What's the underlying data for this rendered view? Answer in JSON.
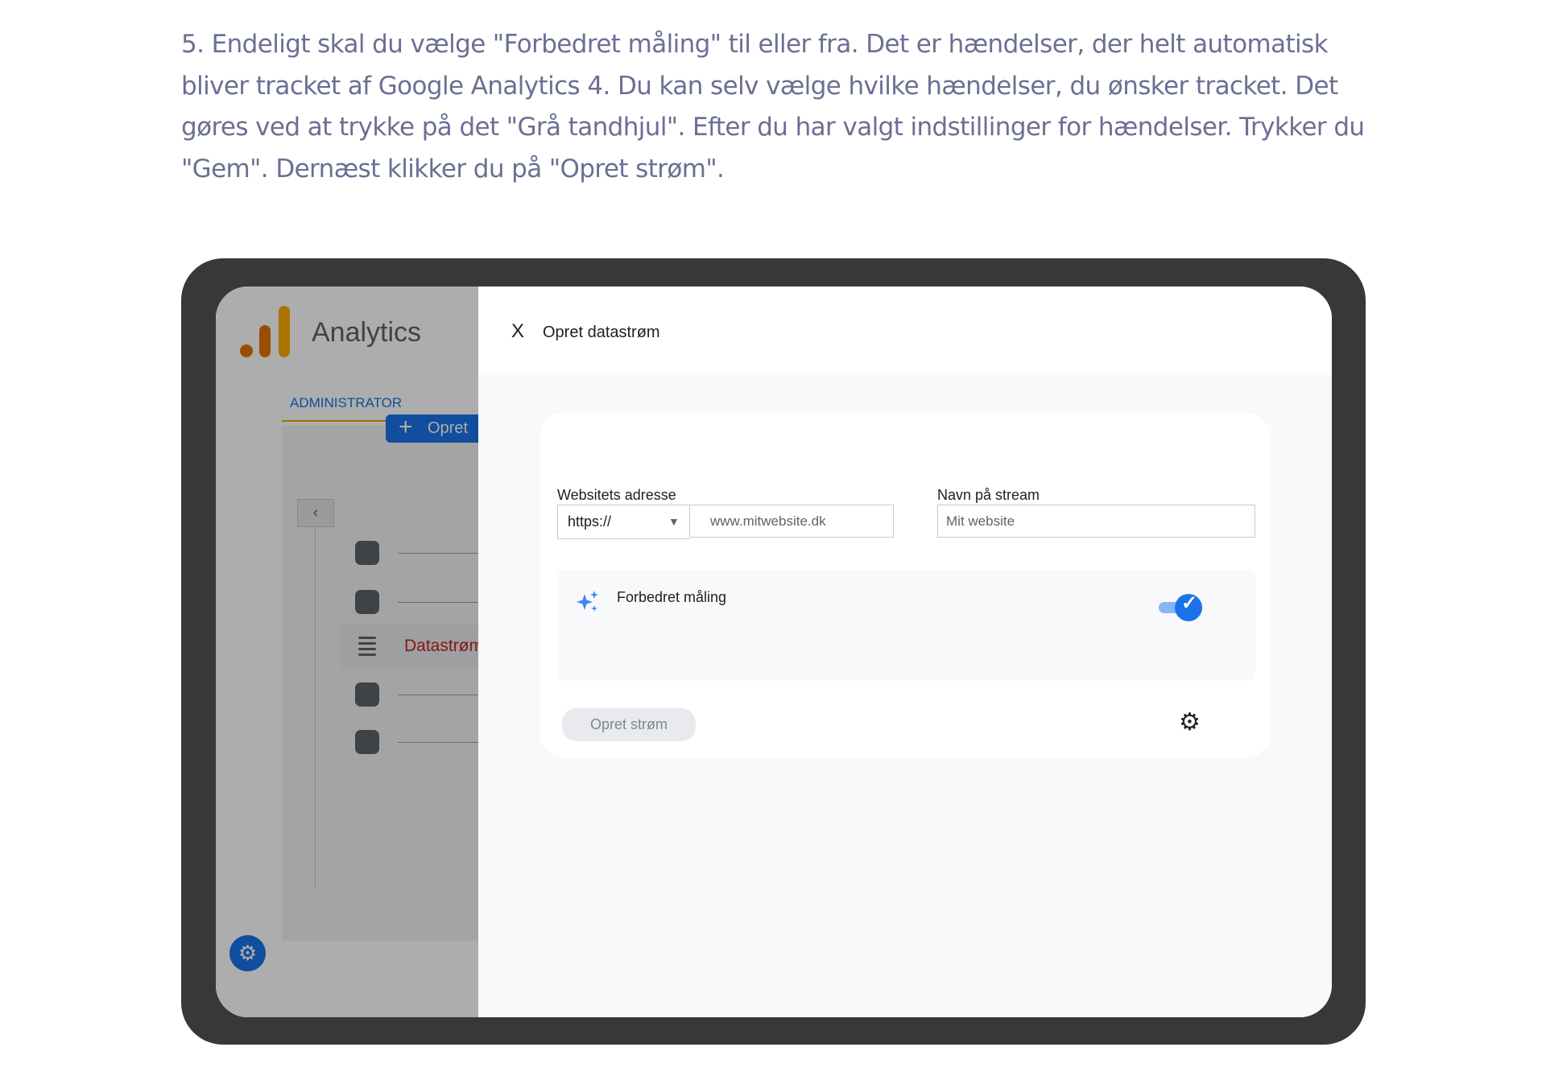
{
  "instruction": "5. Endeligt skal du vælge \"Forbedret måling\" til eller fra. Det er hændelser, der helt automatisk bliver tracket af Google Analytics 4. Du kan selv vælge hvilke hændelser, du ønsker tracket. Det gøres ved at trykke på det \"Grå tandhjul\". Efter du har valgt indstillinger for hændelser. Trykker du \"Gem\". Dernæst klikker du på \"Opret strøm\".",
  "app": {
    "title": "Analytics",
    "admin_tab": "ADMINISTRATOR",
    "create_button": "Opret",
    "create_plus": "+",
    "back": "‹",
    "data_streams": "Datastrøm",
    "gear": "⚙"
  },
  "dialog": {
    "close": "X",
    "title": "Opret datastrøm",
    "website_label": "Websitets adresse",
    "protocol": "https://",
    "protocol_caret": "▼",
    "url_placeholder": "www.mitwebsite.dk",
    "stream_name_label": "Navn på stream",
    "stream_name_placeholder": "Mit website",
    "enhanced_label": "Forbedret måling",
    "enhanced_enabled": true,
    "toggle_check": "✓",
    "create_stream_button": "Opret strøm",
    "gear": "⚙"
  },
  "colors": {
    "instruction_text": "#6b6f94",
    "device_frame": "#383838",
    "accent": "#1a73e8",
    "logo_orange": "#e37400",
    "logo_yellow": "#f9ab00"
  }
}
